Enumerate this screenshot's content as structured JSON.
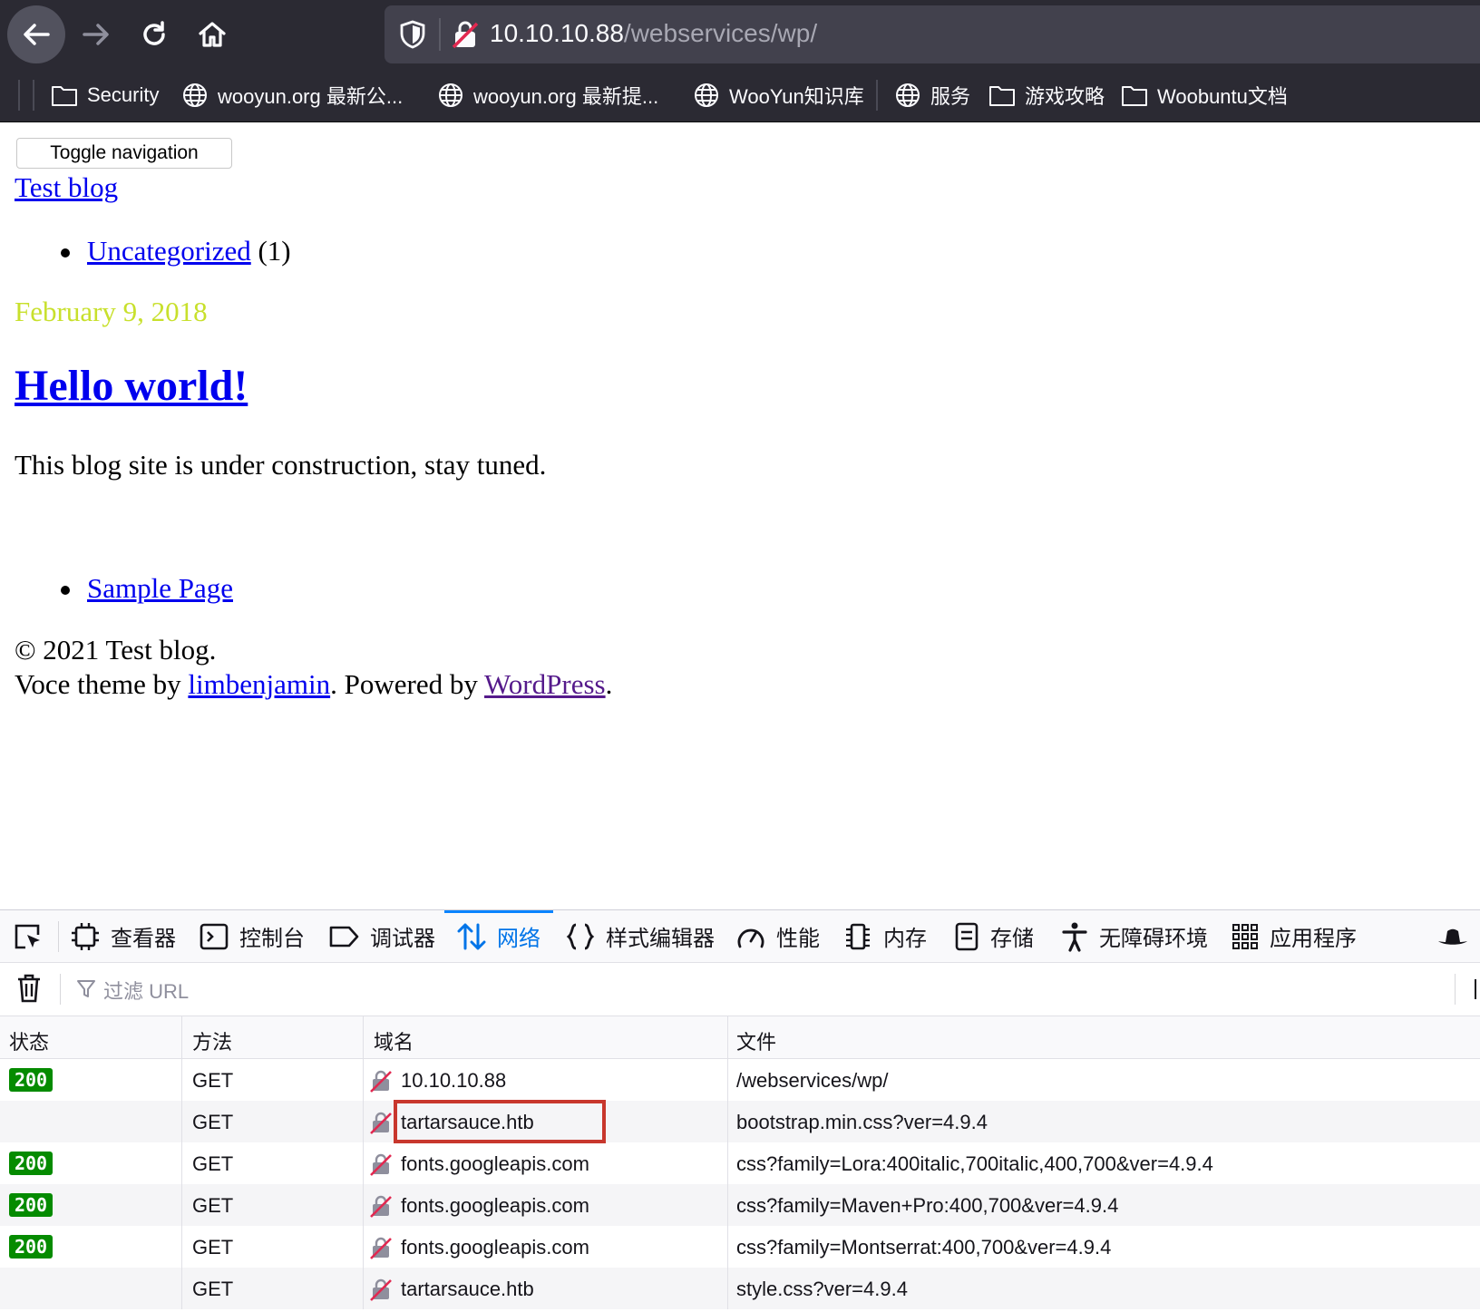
{
  "browser": {
    "url_host": "10.10.10.88",
    "url_path": "/webservices/wp/",
    "bookmarks": [
      {
        "label": "Security",
        "icon": "folder-icon"
      },
      {
        "label": "wooyun.org 最新公...",
        "icon": "globe-icon"
      },
      {
        "label": "wooyun.org 最新提...",
        "icon": "globe-icon"
      },
      {
        "label": "WooYun知识库",
        "icon": "globe-icon"
      },
      {
        "label": "服务",
        "icon": "globe-icon"
      },
      {
        "label": "游戏攻略",
        "icon": "folder-icon"
      },
      {
        "label": "Woobuntu文档",
        "icon": "folder-icon"
      }
    ]
  },
  "page": {
    "toggle_nav": "Toggle navigation",
    "site_title": "Test blog",
    "category_link": "Uncategorized",
    "category_count": " (1)",
    "post_date": "February 9, 2018",
    "post_title": "Hello world!",
    "post_body": "This blog site is under construction, stay tuned.",
    "sample_page": "Sample Page",
    "copyright": "© 2021 Test blog.",
    "theme_prefix": "Voce theme by ",
    "theme_author": "limbenjamin",
    "powered_prefix": ". Powered by ",
    "powered_link": "WordPress",
    "powered_suffix": "."
  },
  "devtools": {
    "tabs": [
      {
        "label": "查看器",
        "icon": "inspector-icon"
      },
      {
        "label": "控制台",
        "icon": "console-icon"
      },
      {
        "label": "调试器",
        "icon": "debugger-icon"
      },
      {
        "label": "网络",
        "icon": "network-icon",
        "active": true
      },
      {
        "label": "样式编辑器",
        "icon": "style-editor-icon"
      },
      {
        "label": "性能",
        "icon": "performance-icon"
      },
      {
        "label": "内存",
        "icon": "memory-icon"
      },
      {
        "label": "存储",
        "icon": "storage-icon"
      },
      {
        "label": "无障碍环境",
        "icon": "accessibility-icon"
      },
      {
        "label": "应用程序",
        "icon": "application-icon"
      }
    ],
    "filter_placeholder": "过滤 URL",
    "columns": [
      "状态",
      "方法",
      "域名",
      "文件"
    ],
    "rows": [
      {
        "status": "200",
        "method": "GET",
        "domain": "10.10.10.88",
        "file": "/webservices/wp/"
      },
      {
        "status": "",
        "method": "GET",
        "domain": "tartarsauce.htb",
        "file": "bootstrap.min.css?ver=4.9.4"
      },
      {
        "status": "200",
        "method": "GET",
        "domain": "fonts.googleapis.com",
        "file": "css?family=Lora:400italic,700italic,400,700&ver=4.9.4"
      },
      {
        "status": "200",
        "method": "GET",
        "domain": "fonts.googleapis.com",
        "file": "css?family=Maven+Pro:400,700&ver=4.9.4"
      },
      {
        "status": "200",
        "method": "GET",
        "domain": "fonts.googleapis.com",
        "file": "css?family=Montserrat:400,700&ver=4.9.4"
      },
      {
        "status": "",
        "method": "GET",
        "domain": "tartarsauce.htb",
        "file": "style.css?ver=4.9.4"
      }
    ]
  },
  "colors": {
    "highlight": "#c8372d",
    "status_ok": "#058b00",
    "date": "#c8e02c",
    "active_tab": "#0074e8"
  }
}
